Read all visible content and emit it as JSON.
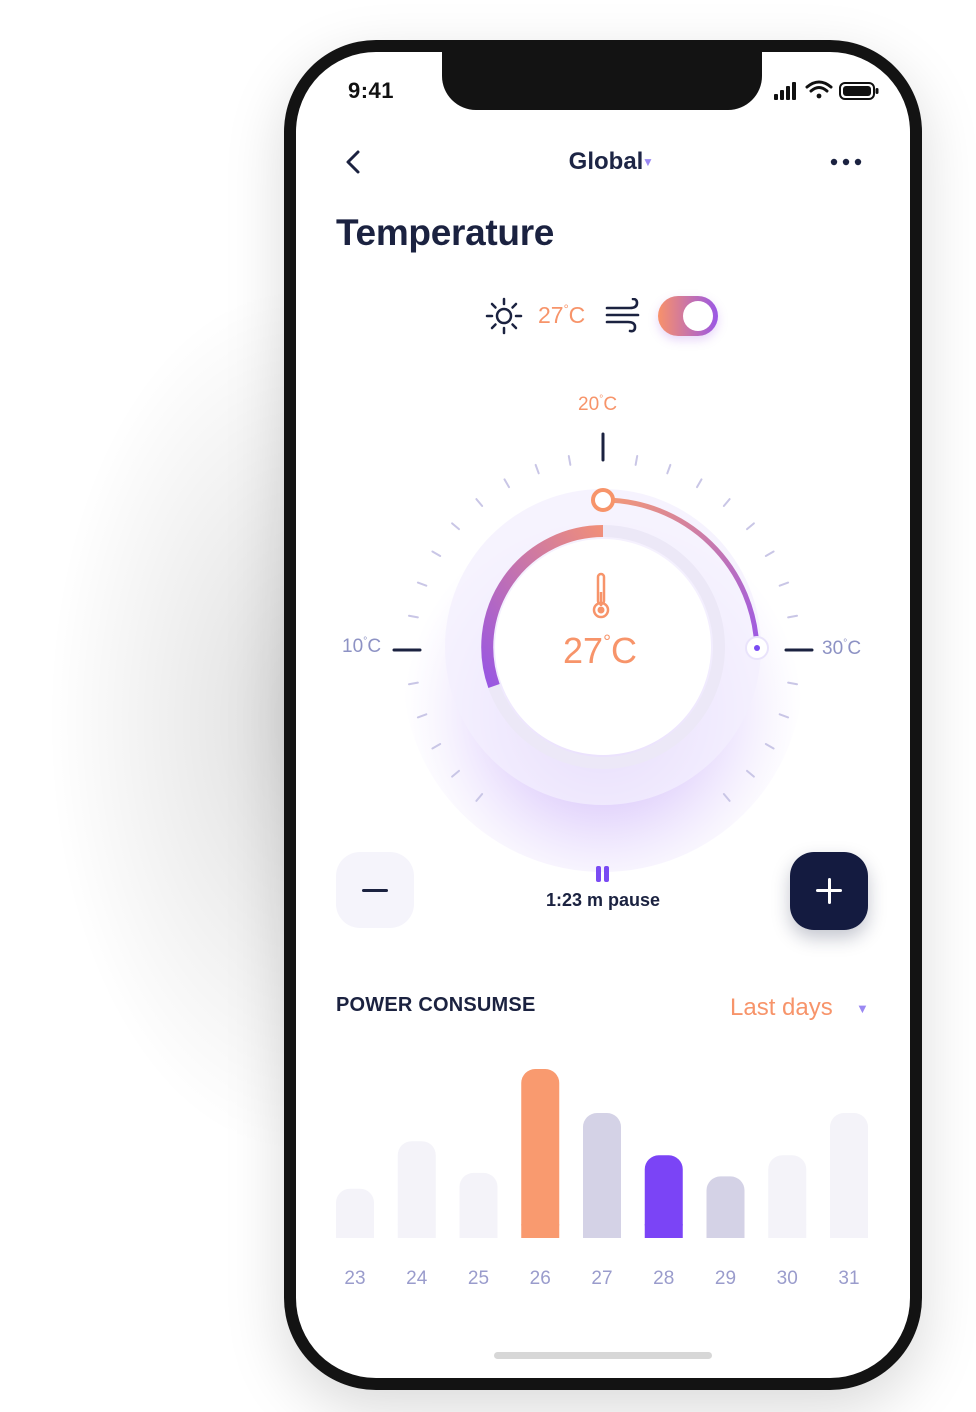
{
  "status_bar": {
    "time": "9:41",
    "icons": [
      "signal-icon",
      "wifi-icon",
      "battery-icon"
    ]
  },
  "nav": {
    "back_icon": "chevron-left-icon",
    "title": "Global",
    "title_caret_icon": "caret-down-icon",
    "more_icon": "more-horizontal-icon"
  },
  "page": {
    "title": "Temperature"
  },
  "mode": {
    "sun_icon": "sun-icon",
    "temp_value": "27",
    "temp_deg": "°",
    "temp_unit": "C",
    "wind_icon": "wind-icon",
    "toggle_on": true
  },
  "dial": {
    "labels": {
      "min": "10",
      "mid": "20",
      "max": "30",
      "deg": "°",
      "unit": "C"
    },
    "current_value": "27",
    "current_deg": "°",
    "current_unit": "C",
    "min": 10,
    "max": 30,
    "current": 27,
    "thermometer_icon": "thermometer-icon"
  },
  "controls": {
    "minus_icon": "minus-icon",
    "plus_icon": "plus-icon",
    "pause_icon": "pause-icon",
    "pause_text": "1:23 m pause"
  },
  "power": {
    "title": "POWER CONSUMSE",
    "range_label": "Last days",
    "range_caret_icon": "caret-down-icon"
  },
  "chart_data": {
    "type": "bar",
    "categories": [
      "23",
      "24",
      "25",
      "26",
      "27",
      "28",
      "29",
      "30",
      "31"
    ],
    "values": [
      28,
      55,
      37,
      96,
      71,
      47,
      35,
      47,
      71
    ],
    "highlight": {
      "26": "#f99a6f",
      "28": "#7b44f6",
      "27": "#d4d2e6",
      "29": "#d4d2e6"
    },
    "default_color": "#f4f3f9",
    "title": "POWER CONSUMSE",
    "xlabel": "",
    "ylabel": ""
  },
  "colors": {
    "accent_orange": "#f7946a",
    "accent_purple": "#7a4bf3",
    "navy": "#141b40"
  }
}
